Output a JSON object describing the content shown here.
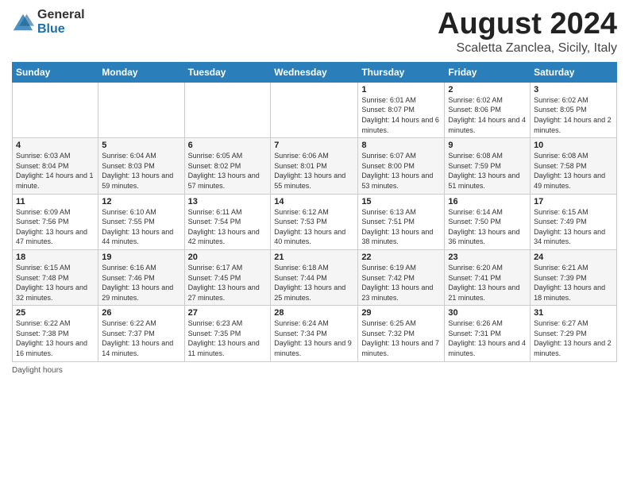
{
  "logo": {
    "general": "General",
    "blue": "Blue"
  },
  "title": "August 2024",
  "subtitle": "Scaletta Zanclea, Sicily, Italy",
  "days_of_week": [
    "Sunday",
    "Monday",
    "Tuesday",
    "Wednesday",
    "Thursday",
    "Friday",
    "Saturday"
  ],
  "footer_text": "Daylight hours",
  "weeks": [
    [
      {
        "day": "",
        "sunrise": "",
        "sunset": "",
        "daylight": ""
      },
      {
        "day": "",
        "sunrise": "",
        "sunset": "",
        "daylight": ""
      },
      {
        "day": "",
        "sunrise": "",
        "sunset": "",
        "daylight": ""
      },
      {
        "day": "",
        "sunrise": "",
        "sunset": "",
        "daylight": ""
      },
      {
        "day": "1",
        "sunrise": "Sunrise: 6:01 AM",
        "sunset": "Sunset: 8:07 PM",
        "daylight": "Daylight: 14 hours and 6 minutes."
      },
      {
        "day": "2",
        "sunrise": "Sunrise: 6:02 AM",
        "sunset": "Sunset: 8:06 PM",
        "daylight": "Daylight: 14 hours and 4 minutes."
      },
      {
        "day": "3",
        "sunrise": "Sunrise: 6:02 AM",
        "sunset": "Sunset: 8:05 PM",
        "daylight": "Daylight: 14 hours and 2 minutes."
      }
    ],
    [
      {
        "day": "4",
        "sunrise": "Sunrise: 6:03 AM",
        "sunset": "Sunset: 8:04 PM",
        "daylight": "Daylight: 14 hours and 1 minute."
      },
      {
        "day": "5",
        "sunrise": "Sunrise: 6:04 AM",
        "sunset": "Sunset: 8:03 PM",
        "daylight": "Daylight: 13 hours and 59 minutes."
      },
      {
        "day": "6",
        "sunrise": "Sunrise: 6:05 AM",
        "sunset": "Sunset: 8:02 PM",
        "daylight": "Daylight: 13 hours and 57 minutes."
      },
      {
        "day": "7",
        "sunrise": "Sunrise: 6:06 AM",
        "sunset": "Sunset: 8:01 PM",
        "daylight": "Daylight: 13 hours and 55 minutes."
      },
      {
        "day": "8",
        "sunrise": "Sunrise: 6:07 AM",
        "sunset": "Sunset: 8:00 PM",
        "daylight": "Daylight: 13 hours and 53 minutes."
      },
      {
        "day": "9",
        "sunrise": "Sunrise: 6:08 AM",
        "sunset": "Sunset: 7:59 PM",
        "daylight": "Daylight: 13 hours and 51 minutes."
      },
      {
        "day": "10",
        "sunrise": "Sunrise: 6:08 AM",
        "sunset": "Sunset: 7:58 PM",
        "daylight": "Daylight: 13 hours and 49 minutes."
      }
    ],
    [
      {
        "day": "11",
        "sunrise": "Sunrise: 6:09 AM",
        "sunset": "Sunset: 7:56 PM",
        "daylight": "Daylight: 13 hours and 47 minutes."
      },
      {
        "day": "12",
        "sunrise": "Sunrise: 6:10 AM",
        "sunset": "Sunset: 7:55 PM",
        "daylight": "Daylight: 13 hours and 44 minutes."
      },
      {
        "day": "13",
        "sunrise": "Sunrise: 6:11 AM",
        "sunset": "Sunset: 7:54 PM",
        "daylight": "Daylight: 13 hours and 42 minutes."
      },
      {
        "day": "14",
        "sunrise": "Sunrise: 6:12 AM",
        "sunset": "Sunset: 7:53 PM",
        "daylight": "Daylight: 13 hours and 40 minutes."
      },
      {
        "day": "15",
        "sunrise": "Sunrise: 6:13 AM",
        "sunset": "Sunset: 7:51 PM",
        "daylight": "Daylight: 13 hours and 38 minutes."
      },
      {
        "day": "16",
        "sunrise": "Sunrise: 6:14 AM",
        "sunset": "Sunset: 7:50 PM",
        "daylight": "Daylight: 13 hours and 36 minutes."
      },
      {
        "day": "17",
        "sunrise": "Sunrise: 6:15 AM",
        "sunset": "Sunset: 7:49 PM",
        "daylight": "Daylight: 13 hours and 34 minutes."
      }
    ],
    [
      {
        "day": "18",
        "sunrise": "Sunrise: 6:15 AM",
        "sunset": "Sunset: 7:48 PM",
        "daylight": "Daylight: 13 hours and 32 minutes."
      },
      {
        "day": "19",
        "sunrise": "Sunrise: 6:16 AM",
        "sunset": "Sunset: 7:46 PM",
        "daylight": "Daylight: 13 hours and 29 minutes."
      },
      {
        "day": "20",
        "sunrise": "Sunrise: 6:17 AM",
        "sunset": "Sunset: 7:45 PM",
        "daylight": "Daylight: 13 hours and 27 minutes."
      },
      {
        "day": "21",
        "sunrise": "Sunrise: 6:18 AM",
        "sunset": "Sunset: 7:44 PM",
        "daylight": "Daylight: 13 hours and 25 minutes."
      },
      {
        "day": "22",
        "sunrise": "Sunrise: 6:19 AM",
        "sunset": "Sunset: 7:42 PM",
        "daylight": "Daylight: 13 hours and 23 minutes."
      },
      {
        "day": "23",
        "sunrise": "Sunrise: 6:20 AM",
        "sunset": "Sunset: 7:41 PM",
        "daylight": "Daylight: 13 hours and 21 minutes."
      },
      {
        "day": "24",
        "sunrise": "Sunrise: 6:21 AM",
        "sunset": "Sunset: 7:39 PM",
        "daylight": "Daylight: 13 hours and 18 minutes."
      }
    ],
    [
      {
        "day": "25",
        "sunrise": "Sunrise: 6:22 AM",
        "sunset": "Sunset: 7:38 PM",
        "daylight": "Daylight: 13 hours and 16 minutes."
      },
      {
        "day": "26",
        "sunrise": "Sunrise: 6:22 AM",
        "sunset": "Sunset: 7:37 PM",
        "daylight": "Daylight: 13 hours and 14 minutes."
      },
      {
        "day": "27",
        "sunrise": "Sunrise: 6:23 AM",
        "sunset": "Sunset: 7:35 PM",
        "daylight": "Daylight: 13 hours and 11 minutes."
      },
      {
        "day": "28",
        "sunrise": "Sunrise: 6:24 AM",
        "sunset": "Sunset: 7:34 PM",
        "daylight": "Daylight: 13 hours and 9 minutes."
      },
      {
        "day": "29",
        "sunrise": "Sunrise: 6:25 AM",
        "sunset": "Sunset: 7:32 PM",
        "daylight": "Daylight: 13 hours and 7 minutes."
      },
      {
        "day": "30",
        "sunrise": "Sunrise: 6:26 AM",
        "sunset": "Sunset: 7:31 PM",
        "daylight": "Daylight: 13 hours and 4 minutes."
      },
      {
        "day": "31",
        "sunrise": "Sunrise: 6:27 AM",
        "sunset": "Sunset: 7:29 PM",
        "daylight": "Daylight: 13 hours and 2 minutes."
      }
    ]
  ]
}
